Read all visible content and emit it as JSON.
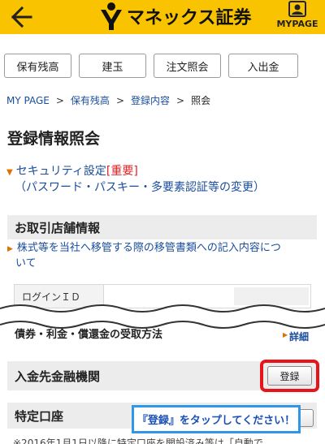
{
  "header": {
    "logo_text": "マネックス証券",
    "mypage_label": "MYPAGE",
    "icons": {
      "back": "arrow-left-icon",
      "logo": "monex-logo-icon",
      "mypage": "person-card-icon"
    },
    "background": "#f9c300"
  },
  "tabs": [
    {
      "label": "保有残高"
    },
    {
      "label": "建玉"
    },
    {
      "label": "注文照会"
    },
    {
      "label": "入出金"
    }
  ],
  "breadcrumb": {
    "items": [
      "MY PAGE",
      "保有残高",
      "登録内容",
      "照会"
    ],
    "separator": ">"
  },
  "page_title": "登録情報照会",
  "security": {
    "link": "セキュリティ設定",
    "important": "[重要]",
    "detail": "（パスワード・パスキー・多要素認証等の変更）"
  },
  "store_section": {
    "title": "お取引店舗情報",
    "transfer_line1": "株式等を当社へ移管する際の移管書類への記入内容につ",
    "transfer_line2": "いて"
  },
  "login_row": {
    "label": "ログインＩＤ"
  },
  "partial_row": {
    "label": "債券・利金・償還金の受取方法",
    "detail": "詳細"
  },
  "bank_section": {
    "title": "入金先金融機関",
    "button": "登録"
  },
  "tokutei_section": {
    "title": "特定口座"
  },
  "callout": {
    "text": "『登録』をタップしてください！"
  },
  "footnote": "※2016年1月1日以降に特定口座を開設済み等は「自動で",
  "colors": {
    "accent": "#f9c300",
    "link": "#1a4d9c",
    "important": "#e02020",
    "highlight": "#e8141b",
    "callout_border": "#2f96e8"
  }
}
